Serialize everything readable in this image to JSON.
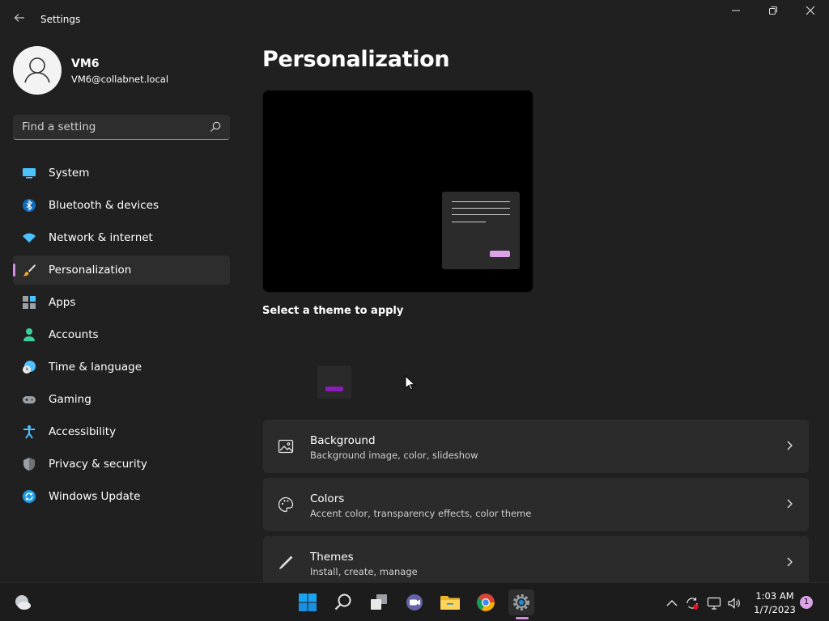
{
  "window": {
    "title": "Settings",
    "back_icon": "back-arrow-icon",
    "minimize_icon": "minimize-icon",
    "maximize_icon": "restore-icon",
    "close_icon": "close-icon"
  },
  "profile": {
    "name": "VM6",
    "email": "VM6@collabnet.local"
  },
  "search": {
    "placeholder": "Find a setting",
    "icon": "search-icon"
  },
  "sidebar": {
    "active_index": 3,
    "accent_color": "#d38ee6",
    "items": [
      {
        "label": "System",
        "icon": "system-icon"
      },
      {
        "label": "Bluetooth & devices",
        "icon": "bluetooth-icon"
      },
      {
        "label": "Network & internet",
        "icon": "wifi-icon"
      },
      {
        "label": "Personalization",
        "icon": "brush-icon"
      },
      {
        "label": "Apps",
        "icon": "apps-icon"
      },
      {
        "label": "Accounts",
        "icon": "person-icon"
      },
      {
        "label": "Time & language",
        "icon": "clock-globe-icon"
      },
      {
        "label": "Gaming",
        "icon": "gamepad-icon"
      },
      {
        "label": "Accessibility",
        "icon": "accessibility-icon"
      },
      {
        "label": "Privacy & security",
        "icon": "shield-icon"
      },
      {
        "label": "Windows Update",
        "icon": "update-icon"
      }
    ]
  },
  "main": {
    "title": "Personalization",
    "select_theme_label": "Select a theme to apply",
    "cards": [
      {
        "title": "Background",
        "subtitle": "Background image, color, slideshow",
        "icon": "image-icon"
      },
      {
        "title": "Colors",
        "subtitle": "Accent color, transparency effects, color theme",
        "icon": "palette-icon"
      },
      {
        "title": "Themes",
        "subtitle": "Install, create, manage",
        "icon": "pen-icon"
      }
    ]
  },
  "taskbar": {
    "apps": [
      "start-icon",
      "search-icon",
      "task-view-icon",
      "teams-chat-icon",
      "file-explorer-icon",
      "chrome-icon",
      "settings-icon"
    ],
    "tray_icons": [
      "chevron-up-icon",
      "sync-icon",
      "network-icon",
      "volume-icon"
    ],
    "time": "1:03 AM",
    "date": "1/7/2023",
    "notification_count": "1"
  }
}
